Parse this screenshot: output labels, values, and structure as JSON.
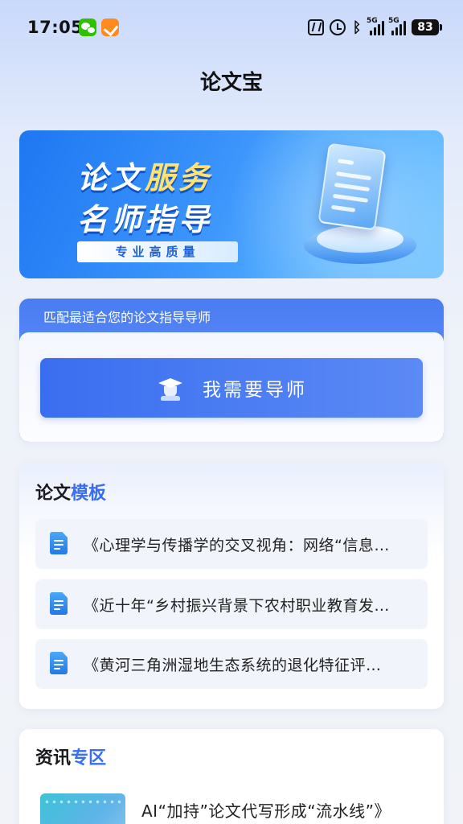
{
  "status_bar": {
    "time": "17:05",
    "network_label": "5G",
    "battery": "83"
  },
  "header": {
    "title": "论文宝"
  },
  "banner": {
    "line1_a": "论文",
    "line1_b": "服务",
    "line2": "名师指导",
    "tag": "专业高质量"
  },
  "mentor": {
    "heading": "匹配最适合您的论文指导导师",
    "button_label": "我需要导师"
  },
  "templates": {
    "title_a": "论文",
    "title_b": "模板",
    "items": [
      "《心理学与传播学的交叉视角：网络“信息…",
      "《近十年“乡村振兴背景下农村职业教育发…",
      "《黄河三角洲湿地生态系统的退化特征评…"
    ]
  },
  "news": {
    "title_a": "资讯",
    "title_b": "专区",
    "items": [
      {
        "title": "AI“加持”论文代写形成“流水线”》"
      }
    ]
  },
  "colors": {
    "accent": "#3a6ef0",
    "banner_blue": "#1f77f2",
    "banner_yellow": "#ffe271"
  }
}
